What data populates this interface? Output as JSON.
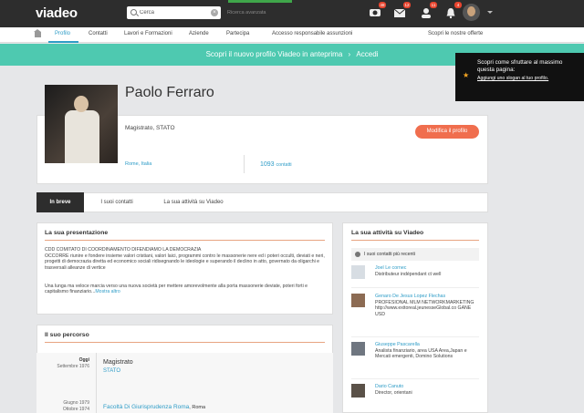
{
  "topbar": {
    "logo_text": "viadeo",
    "search": {
      "value": "Cerca",
      "placeholder": "Cerca"
    },
    "advanced_search": "Ricerca avanzata",
    "icons": [
      {
        "name": "visits-icon",
        "badge": "48"
      },
      {
        "name": "messages-icon",
        "badge": "12"
      },
      {
        "name": "contacts-invite-icon",
        "badge": "11"
      },
      {
        "name": "notifications-icon",
        "badge": "4"
      }
    ]
  },
  "nav": {
    "items": [
      "Profilo",
      "Contatti",
      "Lavori e Formazioni",
      "Aziende",
      "Partecipa",
      "Accesso responsabile assunzioni",
      "Scopri le nostre offerte"
    ]
  },
  "banner": {
    "text": "Scopri il nuovo profilo Viadeo in anteprima",
    "link": "Accedi"
  },
  "popup": {
    "title": "Scopri come sfruttare al massimo questa pagina:",
    "link": "Aggiungi uno slogan al tuo profilo."
  },
  "profile": {
    "name": "Paolo Ferraro",
    "role": "Magistrato, STATO",
    "edit_button": "Modifica il profilo",
    "city": "Rome, Italia",
    "contacts_count": "1093",
    "contacts_label": "contatti"
  },
  "tabs": [
    "In breve",
    "I suoi contatti",
    "La sua attività su Viadeo"
  ],
  "presentation": {
    "title": "La sua presentazione",
    "line1": "CDD COMITATO DI COORDINAMENTO DIFENDIAMO LA DEMOCRAZIA",
    "para1": "OCCORRE riunire e fondere insieme valori cristiani, valori laici, programmi contro le massonerie nere ed i poteri occulti, deviati e neri, progetti di democrazia diretta ed economico sociali ridisegnando le ideologie e superando il declino in atto, governato da oligarchi e trasversali alleanze di vertice",
    "para2": "Una lunga ma veloce marcia verso una nuova società per mettere amorevolmente alla porta massonerie deviate, poteri forti e capitalismo finanziario...",
    "more": "Mostra altro"
  },
  "career": {
    "title": "Il suo percorso",
    "items": [
      {
        "when1": "Oggi",
        "when2": "Settembre 1976",
        "title": "Magistrato",
        "sub": "STATO"
      },
      {
        "when1": "Giugno 1979",
        "when2": "Ottobre 1974",
        "title": "Facoltà Di Giurisprudenza Roma",
        "sub": "Roma"
      }
    ]
  },
  "activity": {
    "title": "La sua attività su Viadeo",
    "header": "I suoi contatti più recenti",
    "people": [
      {
        "name": "Joel Le cornec",
        "desc": "Distributeur indépendant ct well"
      },
      {
        "name": "Genaro De Jesus Lopez Flechas",
        "desc": "PROFESIONAL MLM NETWORKMARKETING http://www.exitoreal.jeunesseGlobal.co GANE USD"
      },
      {
        "name": "Giuseppe Pascarella",
        "desc": "Analista finanziario, area USA Area,Japan e Mercati emergenti, Domino Solutions"
      },
      {
        "name": "Dario Canuto",
        "desc": "Director, orientani"
      }
    ]
  }
}
